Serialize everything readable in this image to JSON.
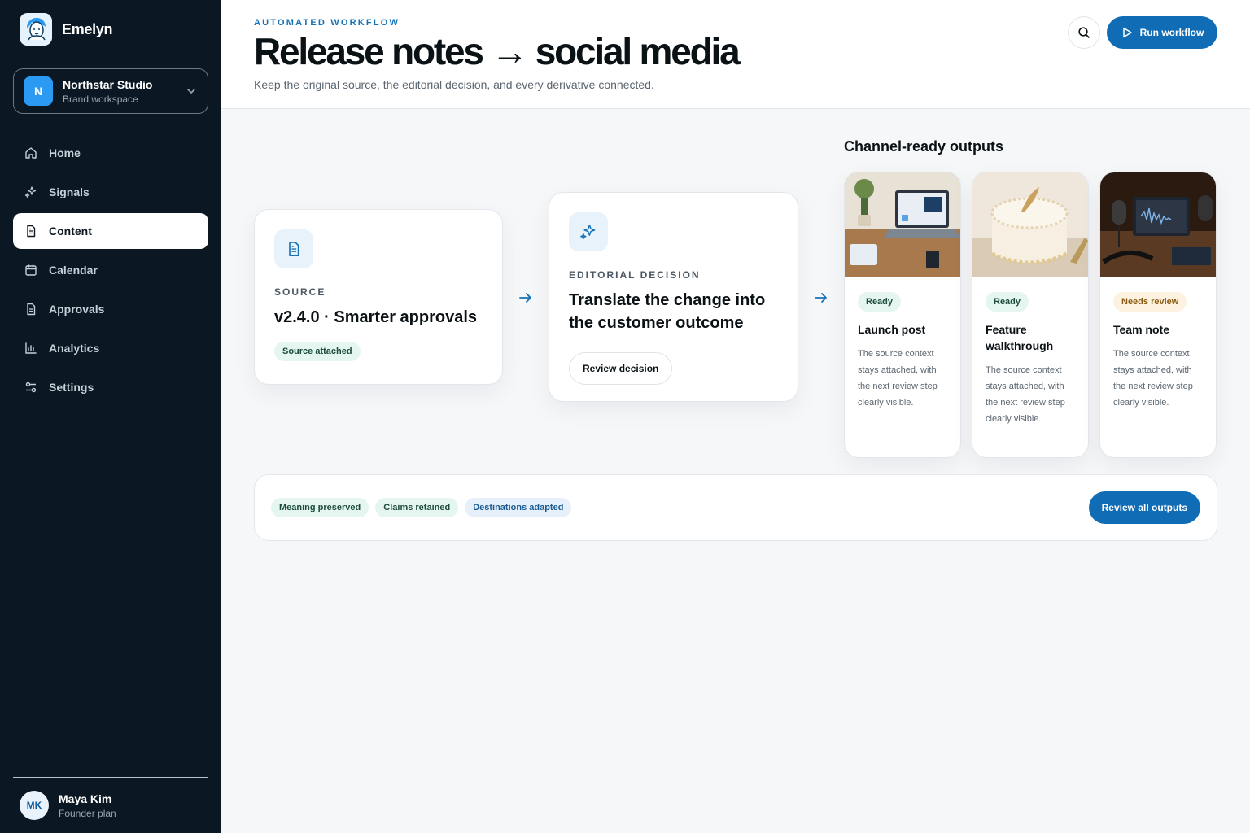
{
  "brand": {
    "name": "Emelyn",
    "logo_icon": "avatar-face-icon"
  },
  "workspace": {
    "initial": "N",
    "name": "Northstar Studio",
    "subtitle": "Brand workspace"
  },
  "nav": [
    {
      "label": "Home",
      "icon": "home-icon",
      "active": false
    },
    {
      "label": "Signals",
      "icon": "sparkle-icon",
      "active": false
    },
    {
      "label": "Content",
      "icon": "document-icon",
      "active": true
    },
    {
      "label": "Calendar",
      "icon": "calendar-icon",
      "active": false
    },
    {
      "label": "Approvals",
      "icon": "document-check-icon",
      "active": false
    },
    {
      "label": "Analytics",
      "icon": "bar-chart-icon",
      "active": false
    },
    {
      "label": "Settings",
      "icon": "sliders-icon",
      "active": false
    }
  ],
  "user": {
    "initials": "MK",
    "name": "Maya Kim",
    "plan": "Founder plan"
  },
  "header": {
    "eyebrow": "AUTOMATED WORKFLOW",
    "title": "Release notes → social media",
    "subtitle": "Keep the original source, the editorial decision, and every derivative connected.",
    "run_label": "Run workflow"
  },
  "source": {
    "kicker": "SOURCE",
    "title": "v2.4.0 · Smarter approvals",
    "badge": "Source attached"
  },
  "decision": {
    "kicker": "EDITORIAL DECISION",
    "title": "Translate the change into the customer outcome",
    "button": "Review decision"
  },
  "outputs": {
    "heading": "Channel-ready outputs",
    "items": [
      {
        "status": "Ready",
        "status_tone": "green",
        "title": "Launch post",
        "desc": "The source context stays attached, with the next review step clearly visible.",
        "image": "laptop-desk-photo"
      },
      {
        "status": "Ready",
        "status_tone": "green",
        "title": "Feature walkthrough",
        "desc": "The source context stays attached, with the next review step clearly visible.",
        "image": "cake-photo"
      },
      {
        "status": "Needs review",
        "status_tone": "amber",
        "title": "Team note",
        "desc": "The source context stays attached, with the next review step clearly visible.",
        "image": "podcast-mic-photo"
      }
    ]
  },
  "summary": {
    "chips": [
      "Meaning preserved",
      "Claims retained",
      "Destinations adapted"
    ],
    "button": "Review all outputs"
  },
  "colors": {
    "sidebar": "#0b1722",
    "accent": "#0f6cb5",
    "page": "#f6f7f9"
  }
}
